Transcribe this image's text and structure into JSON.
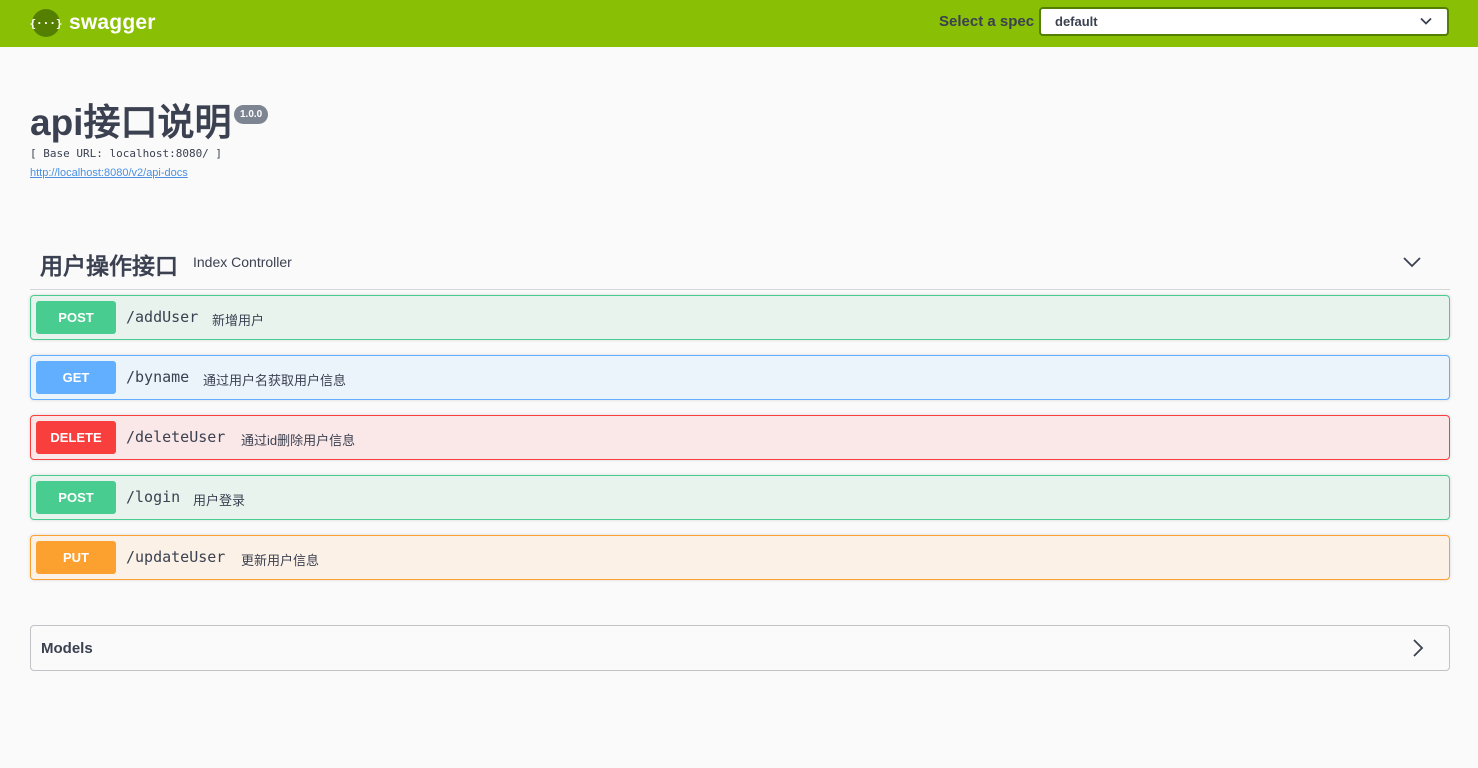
{
  "topbar": {
    "logo_glyph": "{···}",
    "logo_text": "swagger",
    "spec_label": "Select a spec",
    "spec_selected": "default",
    "colors": {
      "bar": "#89bf04",
      "logo_bg": "#547f00"
    }
  },
  "info": {
    "title": "api接口说明",
    "version": "1.0.0",
    "base_url": "[ Base URL: localhost:8080/ ]",
    "docs_link": "http://localhost:8080/v2/api-docs"
  },
  "tag": {
    "name": "用户操作接口",
    "description": "Index Controller",
    "toggle_icon": "chevron-down-icon"
  },
  "operations": [
    {
      "method": "POST",
      "path": "/addUser",
      "summary": "新增用户",
      "color": "#49cc90"
    },
    {
      "method": "GET",
      "path": "/byname",
      "summary": "通过用户名获取用户信息",
      "color": "#61affe"
    },
    {
      "method": "DELETE",
      "path": "/deleteUser",
      "summary": "通过id删除用户信息",
      "color": "#f93e3e"
    },
    {
      "method": "POST",
      "path": "/login",
      "summary": "用户登录",
      "color": "#49cc90"
    },
    {
      "method": "PUT",
      "path": "/updateUser",
      "summary": "更新用户信息",
      "color": "#fca130"
    }
  ],
  "models": {
    "title": "Models",
    "toggle_icon": "chevron-right-icon"
  }
}
